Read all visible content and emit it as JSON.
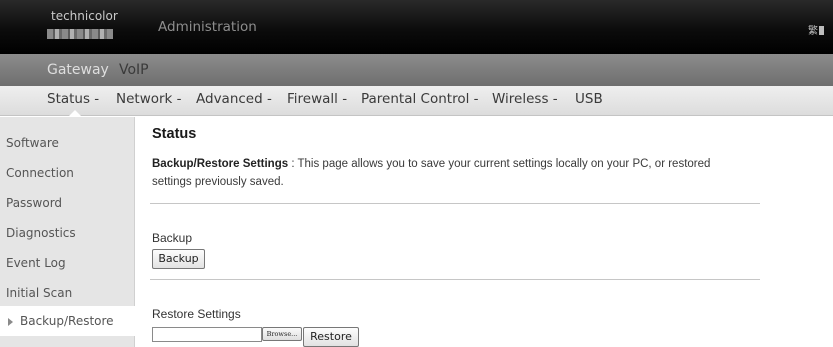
{
  "header": {
    "brand": "technicolor",
    "title": "Administration",
    "language_icon": "language-icon"
  },
  "topnav": {
    "items": [
      "Gateway",
      "VoIP"
    ]
  },
  "mainnav": {
    "items": [
      "Status -",
      "Network -",
      "Advanced -",
      "Firewall -",
      "Parental Control -",
      "Wireless -",
      "USB"
    ]
  },
  "sidebar": {
    "items": [
      "Software",
      "Connection",
      "Password",
      "Diagnostics",
      "Event Log",
      "Initial Scan",
      "Backup/Restore"
    ],
    "active": "Backup/Restore"
  },
  "content": {
    "title": "Status",
    "desc_bold": "Backup/Restore Settings",
    "desc_text": " :  This page allows you to save your current settings locally on your PC, or restored settings previously saved.",
    "backup_label": "Backup",
    "backup_button": "Backup",
    "restore_label": "Restore Settings",
    "file_input_value": "",
    "browse_button": "Browse...",
    "restore_button": "Restore"
  },
  "colors": {
    "topbar": "#000000",
    "gatewaybar": "#7d7d7d",
    "nav": "#e6e6e6",
    "sidebar": "#e5e5e5"
  }
}
